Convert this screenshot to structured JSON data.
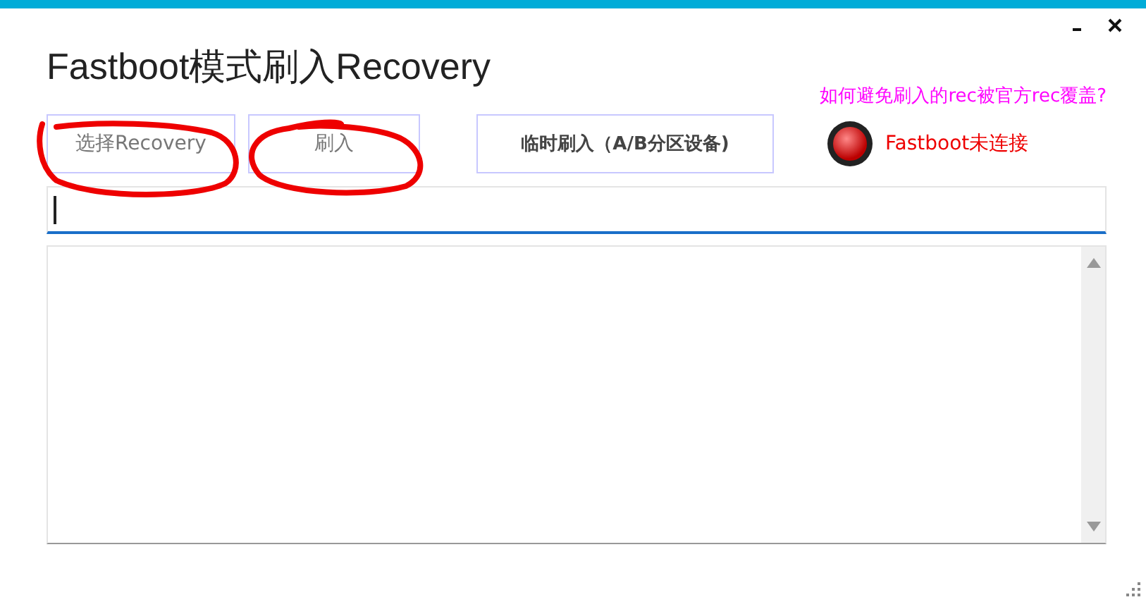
{
  "window": {
    "title": "Fastboot模式刷入Recovery"
  },
  "help_link": "如何避免刷入的rec被官方rec覆盖?",
  "buttons": [
    {
      "label": "选择Recovery",
      "kind": "plain"
    },
    {
      "label": "刷入",
      "kind": "plain"
    },
    {
      "label": "临时刷入（A/B分区设备)",
      "kind": "bold"
    }
  ],
  "status": {
    "text": "Fastboot未连接",
    "connected": false
  },
  "path_field": {
    "focused": true
  },
  "log": {
    "kind": "textarea"
  }
}
